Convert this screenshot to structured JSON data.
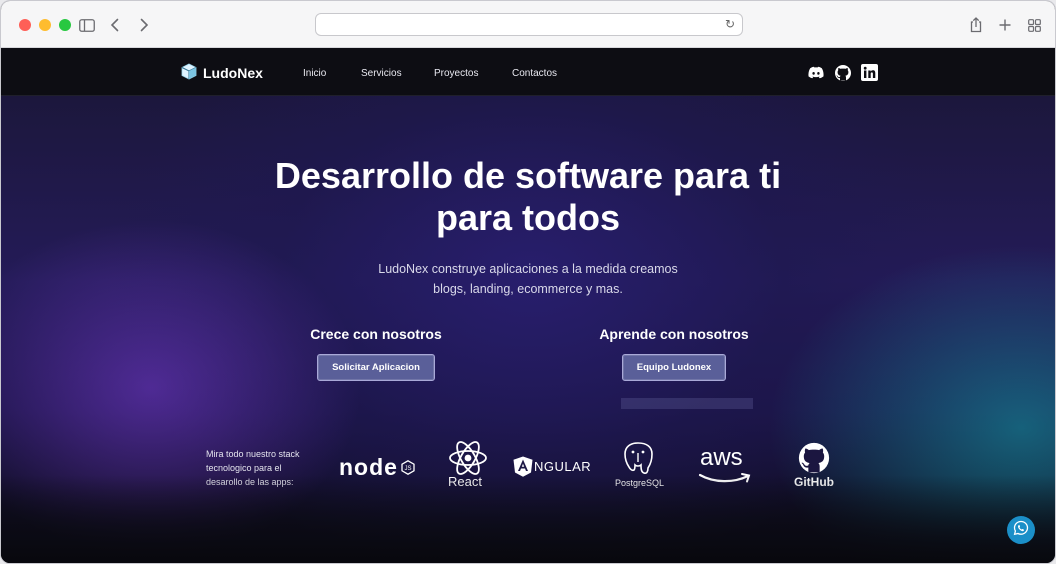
{
  "browser": {
    "address_text": "",
    "reload_icon": "reload-icon"
  },
  "navbar": {
    "brand": "LudoNex",
    "links": [
      "Inicio",
      "Servicios",
      "Proyectos",
      "Contactos"
    ],
    "social_icons": [
      "discord-icon",
      "github-icon",
      "linkedin-icon"
    ]
  },
  "hero": {
    "title_line1": "Desarrollo de software para ti",
    "title_line2": "para todos",
    "subtitle_line1": "LudoNex construye aplicaciones a la medida creamos",
    "subtitle_line2": "blogs, landing, ecommerce y mas."
  },
  "cta": {
    "left_heading": "Crece con nosotros",
    "left_button": "Solicitar Aplicacion",
    "right_heading": "Aprende con nosotros",
    "right_button": "Equipo Ludonex"
  },
  "stack": {
    "text_line1": "Mira todo nuestro stack",
    "text_line2": "tecnologico para el",
    "text_line3": "desarollo de las apps:",
    "logos": {
      "node": "node",
      "react": "React",
      "angular": "NGULAR",
      "postgres": "PostgreSQL",
      "aws": "aws",
      "github": "GitHub"
    }
  },
  "colors": {
    "navbar_bg": "#0d0d13",
    "button_bg": "#5a5f99",
    "whatsapp_bg": "#1b8fc8"
  }
}
